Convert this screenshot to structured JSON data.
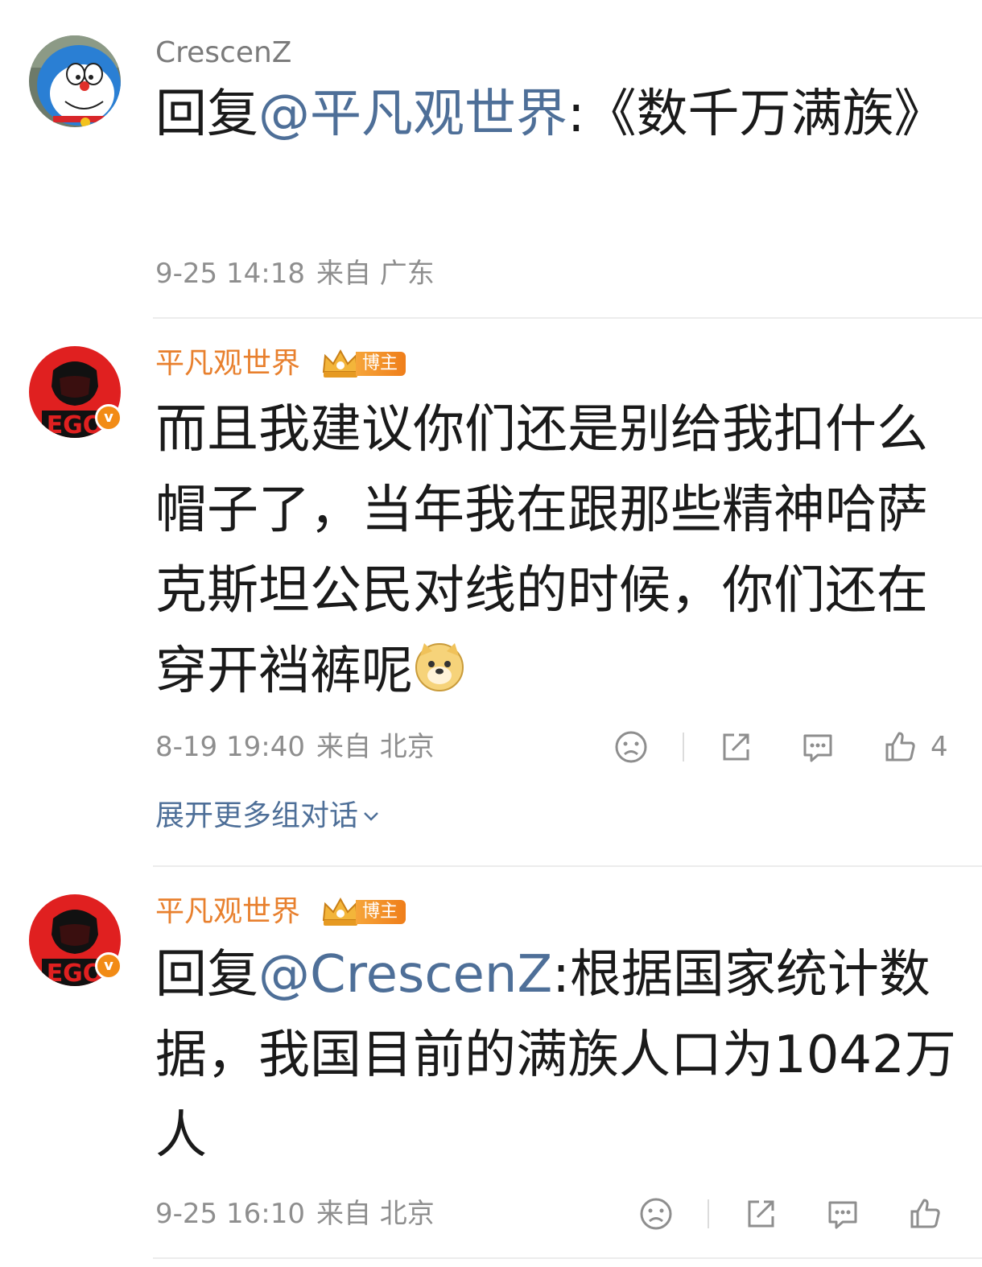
{
  "comments": [
    {
      "username": "CrescenZ",
      "reply_prefix": "回复",
      "mention": "@平凡观世界",
      "text": ":《数千万满族》",
      "date": "9-25 14:18",
      "source": "来自 广东"
    },
    {
      "username": "平凡观世界",
      "badge": "博主",
      "text": "而且我建议你们还是别给我扣什么帽子了，当年我在跟那些精神哈萨克斯坦公民对线的时候，你们还在穿开裆裤呢",
      "emoji": "doge-emoji",
      "date": "8-19 19:40",
      "source": "来自 北京",
      "like_count": "4"
    },
    {
      "username": "平凡观世界",
      "badge": "博主",
      "reply_prefix": "回复",
      "mention": "@CrescenZ",
      "text": ":根据国家统计数据，我国目前的满族人口为1042万人",
      "date": "9-25 16:10",
      "source": "来自 北京"
    }
  ],
  "expand_label": "展开更多组对话",
  "avatar_text": "EGO",
  "colors": {
    "mention": "#4e6f98",
    "username_vip": "#e8802e",
    "badge": "#f28b15"
  }
}
